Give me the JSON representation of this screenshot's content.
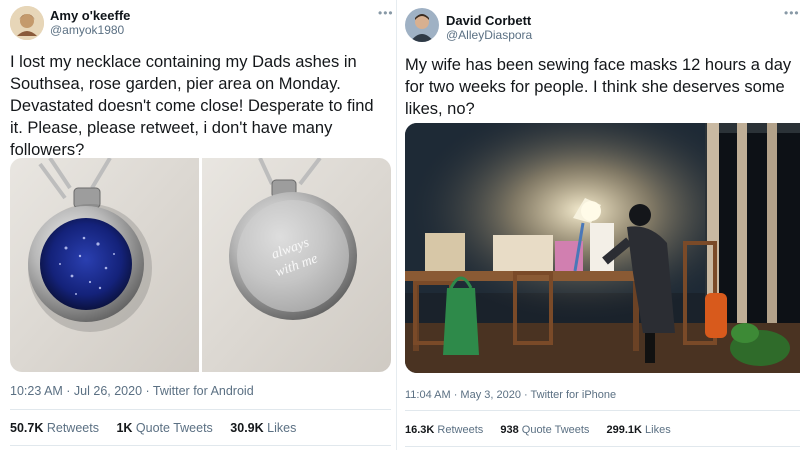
{
  "tweets": [
    {
      "name": "Amy o'keeffe",
      "handle": "@amyok1980",
      "more_icon": "more-icon",
      "text_lines": [
        "I lost my necklace containing my Dads ashes in",
        "Southsea, rose garden, pier area on Monday.",
        "Devastated doesn't come close! Desperate to find",
        "it. Please, please retweet, i don't have many",
        "followers?"
      ],
      "engraving_lines": [
        "always",
        "with me"
      ],
      "time": "10:23 AM · Jul 26, 2020 · Twitter for Android",
      "retweets_count": "50.7K",
      "retweets_label": "Retweets",
      "quotes_count": "1K",
      "quotes_label": "Quote Tweets",
      "likes_count": "30.9K",
      "likes_label": "Likes"
    },
    {
      "name": "David Corbett",
      "handle": "@AlleyDiaspora",
      "more_icon": "more-icon",
      "text_lines": [
        "My wife has been sewing face masks 12 hours a day",
        "for two weeks for people. I think she deserves some",
        "likes, no?"
      ],
      "time": "11:04 AM · May 3, 2020 · Twitter for iPhone",
      "retweets_count": "16.3K",
      "retweets_label": "Retweets",
      "quotes_count": "938",
      "quotes_label": "Quote Tweets",
      "likes_count": "299.1K",
      "likes_label": "Likes"
    }
  ],
  "colors": {
    "text": "#14171a",
    "secondary": "#5b7083",
    "border": "#e1e8ed"
  }
}
